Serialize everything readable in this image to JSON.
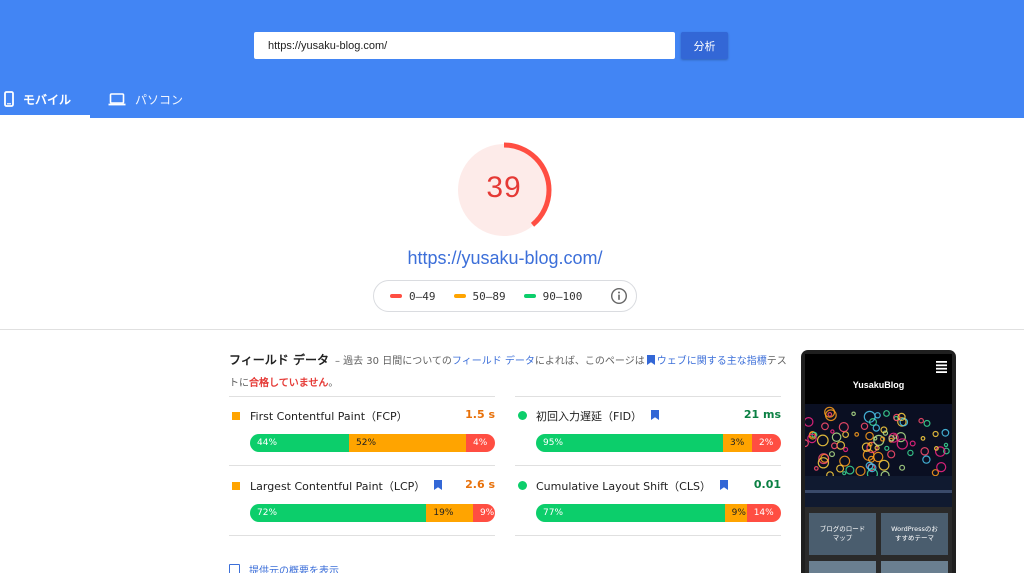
{
  "header": {
    "url_value": "https://yusaku-blog.com/",
    "analyze_label": "分析",
    "tabs": [
      {
        "label": "モバイル",
        "icon": "smartphone-icon",
        "active": true
      },
      {
        "label": "パソコン",
        "icon": "laptop-icon",
        "active": false
      }
    ]
  },
  "score": {
    "value": "39",
    "fraction": 0.39,
    "url": "https://yusaku-blog.com/",
    "color": "#ff4e42"
  },
  "legend": [
    {
      "label": "0–49",
      "color": "#ff4e42"
    },
    {
      "label": "50–89",
      "color": "#ffa400"
    },
    {
      "label": "90–100",
      "color": "#0cce6b"
    }
  ],
  "field_data": {
    "title": "フィールド データ",
    "desc_1": "– 過去 30 日間についての",
    "desc_link_1": "フィールド データ",
    "desc_2": "によれば、このページは",
    "desc_link_2": "ウェブに関する主な指標",
    "desc_3": "テストに",
    "desc_fail": "合格していません",
    "desc_end": "。",
    "metrics": [
      {
        "name": "First Contentful Paint（FCP）",
        "value": "1.5 s",
        "value_color": "#e8710a",
        "marker": "square",
        "bookmark": false,
        "dist": [
          {
            "pct": 44,
            "label": "44%"
          },
          {
            "pct": 52,
            "label": "52%"
          },
          {
            "pct": 4,
            "label": "4%"
          }
        ]
      },
      {
        "name": "初回入力遅延（FID）",
        "value": "21 ms",
        "value_color": "#0b8043",
        "marker": "circle",
        "bookmark": true,
        "dist": [
          {
            "pct": 95,
            "label": "95%"
          },
          {
            "pct": 3,
            "label": "3%"
          },
          {
            "pct": 2,
            "label": "2%"
          }
        ]
      },
      {
        "name": "Largest Contentful Paint（LCP）",
        "value": "2.6 s",
        "value_color": "#e8710a",
        "marker": "square",
        "bookmark": true,
        "dist": [
          {
            "pct": 72,
            "label": "72%"
          },
          {
            "pct": 19,
            "label": "19%"
          },
          {
            "pct": 9,
            "label": "9%"
          }
        ]
      },
      {
        "name": "Cumulative Layout Shift（CLS）",
        "value": "0.01",
        "value_color": "#0b8043",
        "marker": "circle",
        "bookmark": true,
        "dist": [
          {
            "pct": 77,
            "label": "77%"
          },
          {
            "pct": 9,
            "label": "9%"
          },
          {
            "pct": 14,
            "label": "14%"
          }
        ]
      }
    ],
    "summary_link": "提供元の概要を表示"
  },
  "phone_preview": {
    "site_title": "YusakuBlog",
    "card_1": "ブログのロード\nマップ",
    "card_2": "WordPressのお\nすすめテーマ"
  }
}
